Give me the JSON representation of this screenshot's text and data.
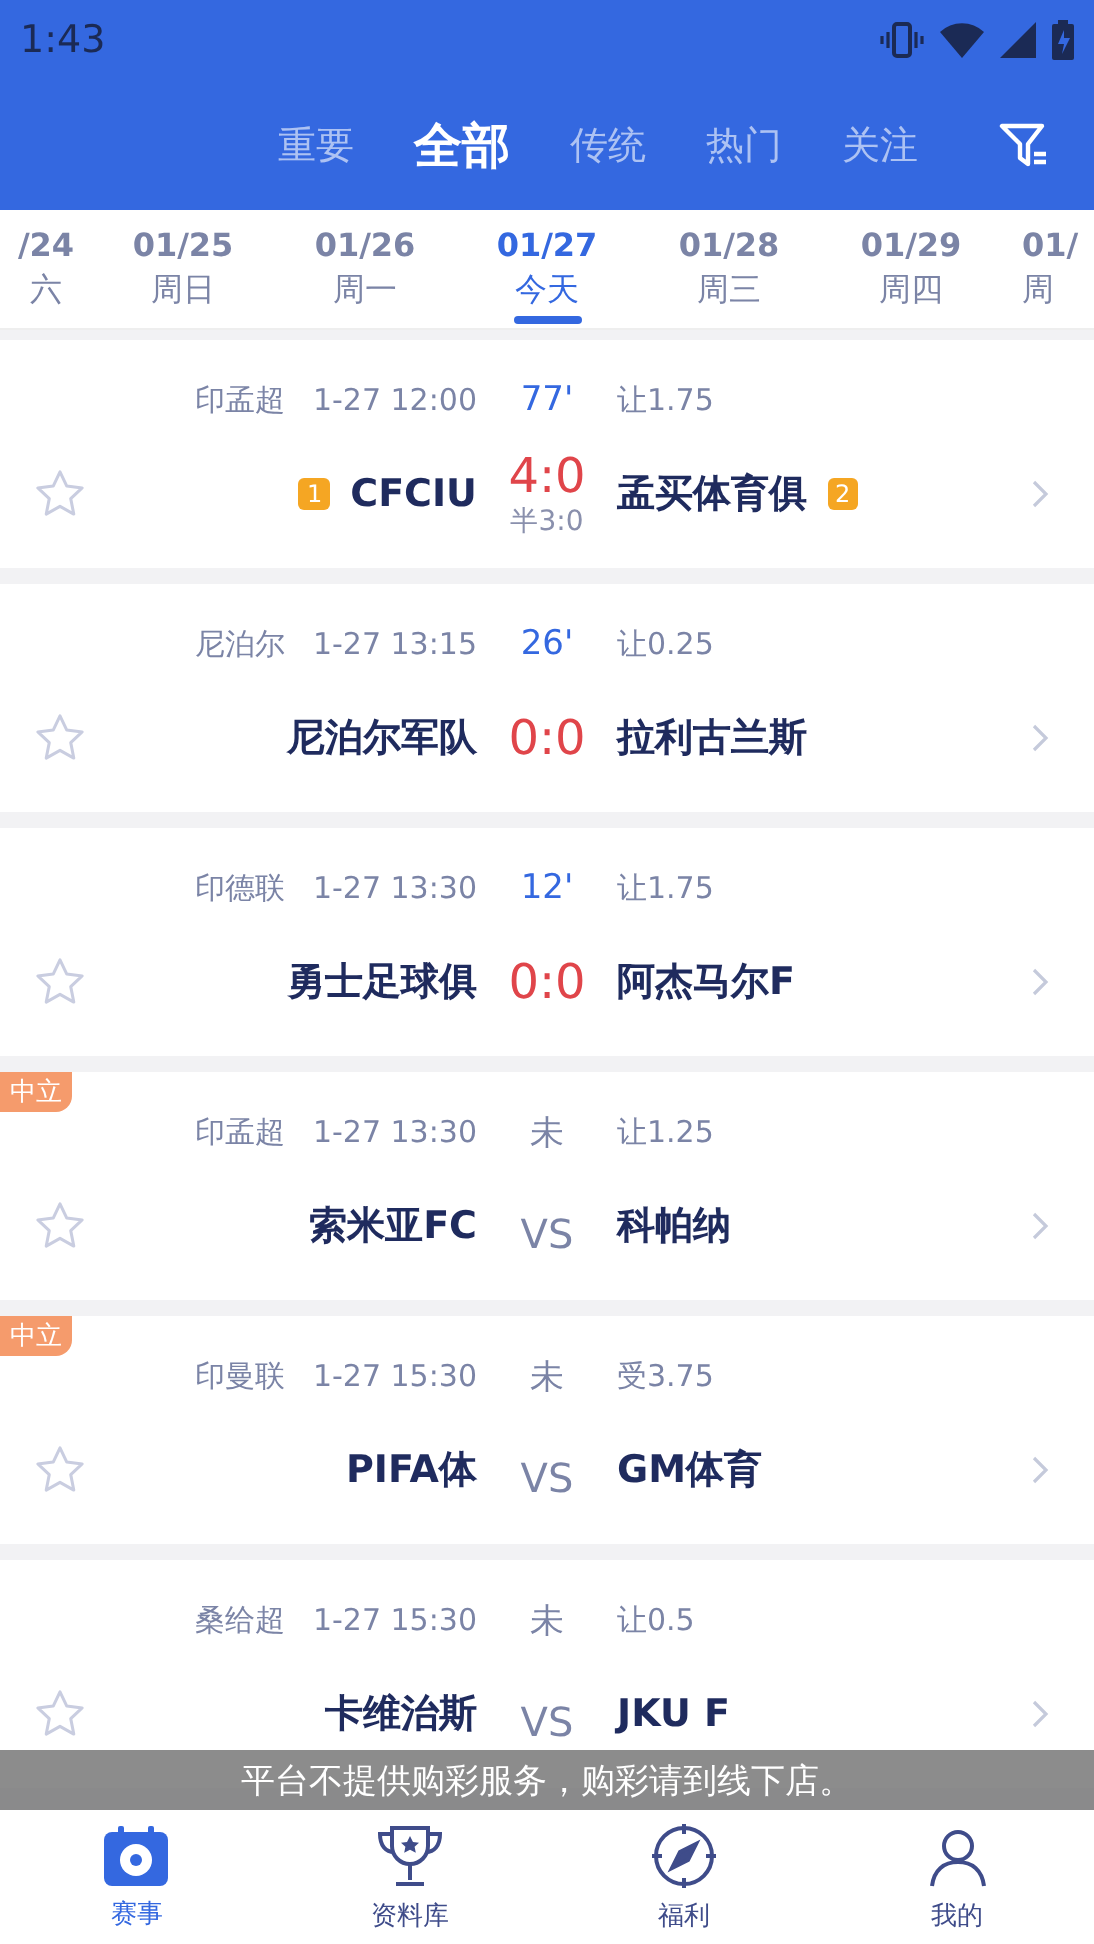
{
  "status_bar": {
    "time": "1:43"
  },
  "tabs": [
    {
      "label": "重要",
      "selected": false
    },
    {
      "label": "全部",
      "selected": true
    },
    {
      "label": "传统",
      "selected": false
    },
    {
      "label": "热门",
      "selected": false
    },
    {
      "label": "关注",
      "selected": false
    }
  ],
  "dates": [
    {
      "date": "/24",
      "day": "六",
      "selected": false
    },
    {
      "date": "01/25",
      "day": "周日",
      "selected": false
    },
    {
      "date": "01/26",
      "day": "周一",
      "selected": false
    },
    {
      "date": "01/27",
      "day": "今天",
      "selected": true
    },
    {
      "date": "01/28",
      "day": "周三",
      "selected": false
    },
    {
      "date": "01/29",
      "day": "周四",
      "selected": false
    },
    {
      "date": "01/",
      "day": "周",
      "selected": false
    }
  ],
  "matches": [
    {
      "kind": "live",
      "neutral": false,
      "starred": false,
      "league": "印孟超",
      "time": "1-27 12:00",
      "status": "77'",
      "handicap": "让1.75",
      "home": "CFCIU",
      "home_rank": "1",
      "score": "4:0",
      "half": "半3:0",
      "away": "孟买体育俱",
      "away_rank": "2"
    },
    {
      "kind": "live",
      "neutral": false,
      "starred": false,
      "league": "尼泊尔",
      "time": "1-27 13:15",
      "status": "26'",
      "handicap": "让0.25",
      "home": "尼泊尔军队",
      "score": "0:0",
      "away": "拉利古兰斯"
    },
    {
      "kind": "live",
      "neutral": false,
      "starred": false,
      "league": "印德联",
      "time": "1-27 13:30",
      "status": "12'",
      "handicap": "让1.75",
      "home": "勇士足球俱",
      "score": "0:0",
      "away": "阿杰马尔F"
    },
    {
      "kind": "upcoming",
      "neutral": true,
      "neutral_label": "中立",
      "starred": false,
      "league": "印孟超",
      "time": "1-27 13:30",
      "status": "未",
      "handicap": "让1.25",
      "home": "索米亚FC",
      "score": "VS",
      "away": "科帕纳"
    },
    {
      "kind": "upcoming",
      "neutral": true,
      "neutral_label": "中立",
      "starred": false,
      "league": "印曼联",
      "time": "1-27 15:30",
      "status": "未",
      "handicap": "受3.75",
      "home": "PIFA体",
      "score": "VS",
      "away": "GM体育"
    },
    {
      "kind": "upcoming",
      "neutral": false,
      "starred": false,
      "league": "桑给超",
      "time": "1-27 15:30",
      "status": "未",
      "handicap": "让0.5",
      "home": "卡维治斯",
      "score": "VS",
      "away": "JKU F"
    }
  ],
  "notice": "平台不提供购彩服务，购彩请到线下店。",
  "bottom_nav": [
    {
      "label": "赛事",
      "selected": true
    },
    {
      "label": "资料库",
      "selected": false
    },
    {
      "label": "福利",
      "selected": false
    },
    {
      "label": "我的",
      "selected": false
    }
  ]
}
